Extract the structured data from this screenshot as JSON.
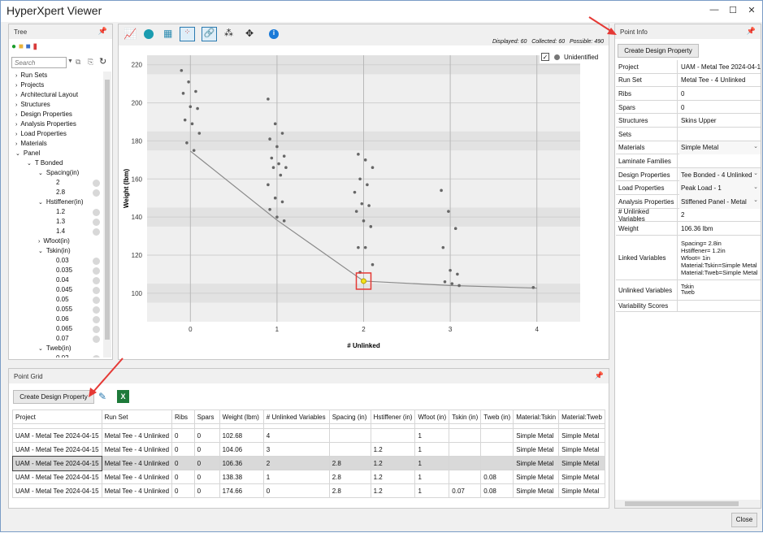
{
  "window": {
    "title": "HyperXpert Viewer",
    "min": "—",
    "max": "☐",
    "close": "✕",
    "close_button": "Close"
  },
  "tree": {
    "title": "Tree",
    "search_placeholder": "Search",
    "items": [
      "Run Sets",
      "Projects",
      "Architectural Layout",
      "Structures",
      "Design Properties",
      "Analysis Properties",
      "Load Properties",
      "Materials",
      "Panel",
      "T Bonded",
      "Spacing(in)",
      "2",
      "2.8",
      "Hstiffener(in)",
      "1.2",
      "1.3",
      "1.4",
      "Wfoot(in)",
      "Tskin(in)",
      "0.03",
      "0.035",
      "0.04",
      "0.045",
      "0.05",
      "0.055",
      "0.06",
      "0.065",
      "0.07",
      "Tweb(in)",
      "0.02"
    ]
  },
  "chart": {
    "stats": {
      "displayed_label": "Displayed:",
      "displayed": "60",
      "collected_label": "Collected:",
      "collected": "60",
      "possible_label": "Possible:",
      "possible": "490"
    },
    "legend": "Unidentified"
  },
  "chart_data": {
    "type": "scatter",
    "xlabel": "# Unlinked",
    "ylabel": "Weight (lbm)",
    "xlim": [
      -0.5,
      4.5
    ],
    "ylim": [
      85,
      225
    ],
    "xticks": [
      "0",
      "1",
      "2",
      "3",
      "4"
    ],
    "yticks": [
      "100",
      "120",
      "140",
      "160",
      "180",
      "200",
      "220"
    ],
    "points": [
      [
        0,
        217
      ],
      [
        0,
        211
      ],
      [
        0,
        206
      ],
      [
        0,
        205
      ],
      [
        0,
        198
      ],
      [
        0,
        197
      ],
      [
        0,
        191
      ],
      [
        0,
        189
      ],
      [
        0,
        184
      ],
      [
        0,
        179
      ],
      [
        0,
        175
      ],
      [
        1,
        202
      ],
      [
        1,
        189
      ],
      [
        1,
        184
      ],
      [
        1,
        181
      ],
      [
        1,
        177
      ],
      [
        1,
        172
      ],
      [
        1,
        171
      ],
      [
        1,
        168
      ],
      [
        1,
        166
      ],
      [
        1,
        166
      ],
      [
        1,
        162
      ],
      [
        1,
        157
      ],
      [
        1,
        150
      ],
      [
        1,
        148
      ],
      [
        1,
        144
      ],
      [
        1,
        140
      ],
      [
        1,
        138
      ],
      [
        2,
        173
      ],
      [
        2,
        170
      ],
      [
        2,
        166
      ],
      [
        2,
        160
      ],
      [
        2,
        157
      ],
      [
        2,
        153
      ],
      [
        2,
        147
      ],
      [
        2,
        146
      ],
      [
        2,
        143
      ],
      [
        2,
        138
      ],
      [
        2,
        135
      ],
      [
        2,
        124
      ],
      [
        2,
        124
      ],
      [
        2,
        115
      ],
      [
        2,
        111
      ],
      [
        2,
        106.36
      ],
      [
        3,
        154
      ],
      [
        3,
        143
      ],
      [
        3,
        134
      ],
      [
        3,
        124
      ],
      [
        3,
        112
      ],
      [
        3,
        110
      ],
      [
        3,
        106
      ],
      [
        3,
        105
      ],
      [
        3,
        104
      ],
      [
        4,
        103
      ]
    ],
    "frontier": [
      [
        0,
        174.66
      ],
      [
        1,
        138.38
      ],
      [
        2,
        106.36
      ],
      [
        3,
        104.06
      ],
      [
        4,
        102.68
      ]
    ],
    "selected": [
      2,
      106.36
    ]
  },
  "point_info": {
    "title": "Point Info",
    "create_button": "Create Design Property",
    "rows": [
      [
        "Project",
        "UAM - Metal Tee 2024-04-1"
      ],
      [
        "Run Set",
        "Metal Tee - 4 Unlinked"
      ],
      [
        "Ribs",
        "0"
      ],
      [
        "Spars",
        "0"
      ],
      [
        "Structures",
        "Skins Upper"
      ],
      [
        "Sets",
        ""
      ],
      [
        "Materials",
        "Simple Metal"
      ],
      [
        "Laminate Families",
        ""
      ],
      [
        "Design Properties",
        "Tee Bonded - 4 Unlinked"
      ],
      [
        "Load Properties",
        "Peak Load - 1"
      ],
      [
        "Analysis Properties",
        "Stiffened Panel - Metal"
      ],
      [
        "# Unlinked Variables",
        "2"
      ],
      [
        "Weight",
        "106.36 lbm"
      ]
    ],
    "linked_label": "Linked Variables",
    "linked": [
      "Spacing= 2.8in",
      "Hstiffener= 1.2in",
      "Wfoot= 1in",
      "Material:Tskin=Simple Metal",
      "Material:Tweb=Simple Metal"
    ],
    "unlinked_label": "Unlinked Variables",
    "unlinked": [
      "Tskin",
      "Tweb"
    ],
    "variability": "Variability Scores"
  },
  "grid": {
    "title": "Point Grid",
    "create_button": "Create Design Property",
    "headers": [
      "Project",
      "Run Set",
      "Ribs",
      "Spars",
      "Weight (lbm)",
      "# Unlinked Variables",
      "Spacing (in)",
      "Hstiffener (in)",
      "Wfoot (in)",
      "Tskin (in)",
      "Tweb (in)",
      "Material:Tskin",
      "Material:Tweb"
    ],
    "rows": [
      [
        "UAM - Metal Tee 2024-04-15",
        "Metal Tee - 4 Unlinked",
        "0",
        "0",
        "102.68",
        "4",
        "",
        "",
        "1",
        "",
        "",
        "Simple Metal",
        "Simple Metal"
      ],
      [
        "UAM - Metal Tee 2024-04-15",
        "Metal Tee - 4 Unlinked",
        "0",
        "0",
        "104.06",
        "3",
        "",
        "1.2",
        "1",
        "",
        "",
        "Simple Metal",
        "Simple Metal"
      ],
      [
        "UAM - Metal Tee 2024-04-15",
        "Metal Tee - 4 Unlinked",
        "0",
        "0",
        "106.36",
        "2",
        "2.8",
        "1.2",
        "1",
        "",
        "",
        "Simple Metal",
        "Simple Metal"
      ],
      [
        "UAM - Metal Tee 2024-04-15",
        "Metal Tee - 4 Unlinked",
        "0",
        "0",
        "138.38",
        "1",
        "2.8",
        "1.2",
        "1",
        "",
        "0.08",
        "Simple Metal",
        "Simple Metal"
      ],
      [
        "UAM - Metal Tee 2024-04-15",
        "Metal Tee - 4 Unlinked",
        "0",
        "0",
        "174.66",
        "0",
        "2.8",
        "1.2",
        "1",
        "0.07",
        "0.08",
        "Simple Metal",
        "Simple Metal"
      ]
    ]
  }
}
